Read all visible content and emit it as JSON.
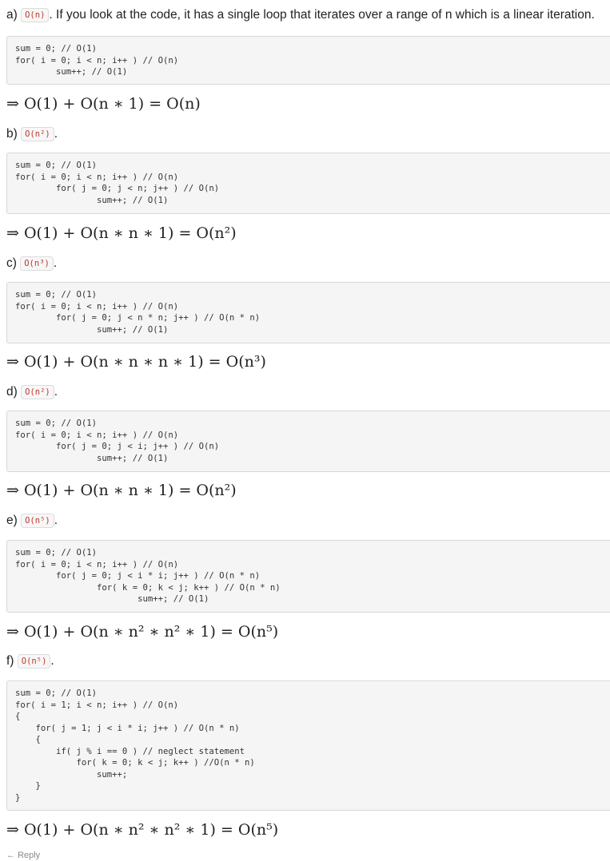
{
  "sections": [
    {
      "letter": "a)",
      "complexity": "O(n)",
      "text": ". If you look at the code, it has a single loop that iterates over a range of n which is a linear iteration.",
      "code": "sum = 0; // O(1)\nfor( i = 0; i < n; i++ ) // O(n)\n        sum++; // O(1)",
      "math": "⇒ O(1) + O(n ∗ 1) = O(n)"
    },
    {
      "letter": "b)",
      "complexity": "O(n²)",
      "text": ".",
      "code": "sum = 0; // O(1)\nfor( i = 0; i < n; i++ ) // O(n)\n        for( j = 0; j < n; j++ ) // O(n)\n                sum++; // O(1)",
      "math": "⇒ O(1) + O(n ∗ n ∗ 1) = O(n²)"
    },
    {
      "letter": "c)",
      "complexity": "O(n³)",
      "text": ".",
      "code": "sum = 0; // O(1)\nfor( i = 0; i < n; i++ ) // O(n)\n        for( j = 0; j < n * n; j++ ) // O(n * n)\n                sum++; // O(1)",
      "math": "⇒ O(1) + O(n ∗ n ∗ n ∗ 1) = O(n³)"
    },
    {
      "letter": "d)",
      "complexity": "O(n²)",
      "text": ".",
      "code": "sum = 0; // O(1)\nfor( i = 0; i < n; i++ ) // O(n)\n        for( j = 0; j < i; j++ ) // O(n)\n                sum++; // O(1)",
      "math": "⇒ O(1) + O(n ∗ n ∗ 1) = O(n²)"
    },
    {
      "letter": "e)",
      "complexity": "O(n⁵)",
      "text": ".",
      "code": "sum = 0; // O(1)\nfor( i = 0; i < n; i++ ) // O(n)\n        for( j = 0; j < i * i; j++ ) // O(n * n)\n                for( k = 0; k < j; k++ ) // O(n * n)\n                        sum++; // O(1)",
      "math": "⇒ O(1) + O(n ∗ n² ∗ n² ∗ 1) = O(n⁵)"
    },
    {
      "letter": "f)",
      "complexity": "O(n⁵)",
      "text": ".",
      "code": "sum = 0; // O(1)\nfor( i = 1; i < n; i++ ) // O(n)\n{\n    for( j = 1; j < i * i; j++ ) // O(n * n)\n    {\n        if( j % i == 0 ) // neglect statement\n            for( k = 0; k < j; k++ ) //O(n * n)\n                sum++;\n    }\n}",
      "math": "⇒ O(1) + O(n ∗ n² ∗ n² ∗ 1) = O(n⁵)"
    }
  ],
  "footer": {
    "reply_icon": "reply-arrow-icon",
    "reply_label": "Reply"
  }
}
